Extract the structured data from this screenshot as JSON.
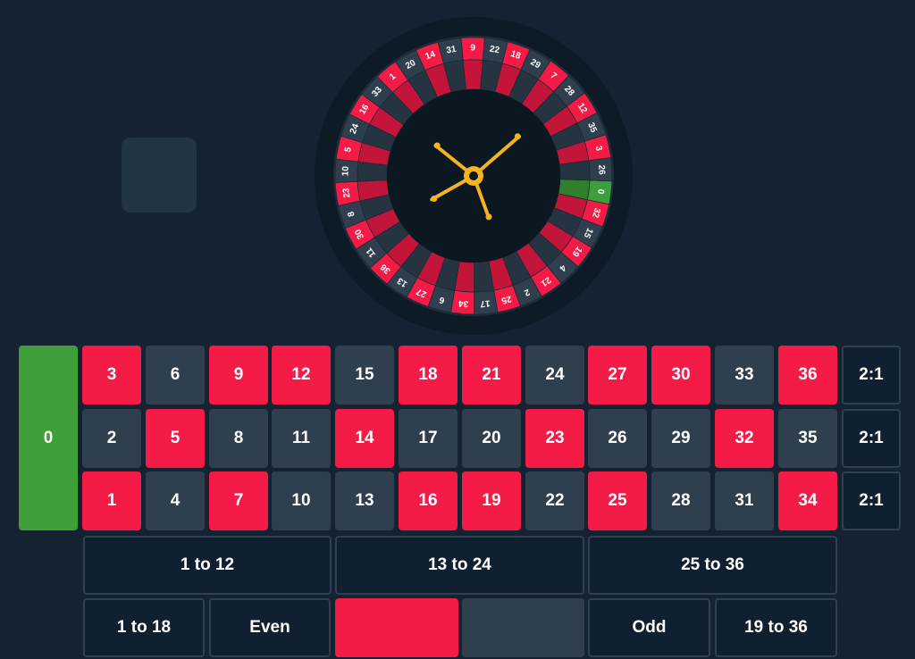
{
  "colors": {
    "background": "#142231",
    "red": "#f41b46",
    "black": "#2f3f4e",
    "green": "#3e9e3a",
    "pointer": "#f5b321"
  },
  "last_result": "",
  "wheel": {
    "sequence": [
      0,
      32,
      15,
      19,
      4,
      21,
      2,
      25,
      17,
      34,
      6,
      27,
      13,
      36,
      11,
      30,
      8,
      23,
      10,
      5,
      24,
      16,
      33,
      1,
      20,
      14,
      31,
      9,
      22,
      18,
      29,
      7,
      28,
      12,
      35,
      3,
      26
    ],
    "red_numbers": [
      1,
      3,
      5,
      7,
      9,
      12,
      14,
      16,
      18,
      19,
      21,
      23,
      25,
      27,
      30,
      32,
      34,
      36
    ],
    "icon": "roulette-spinner-icon"
  },
  "board": {
    "zero": "0",
    "rows": [
      [
        "3",
        "6",
        "9",
        "12",
        "15",
        "18",
        "21",
        "24",
        "27",
        "30",
        "33",
        "36"
      ],
      [
        "2",
        "5",
        "8",
        "11",
        "14",
        "17",
        "20",
        "23",
        "26",
        "29",
        "32",
        "35"
      ],
      [
        "1",
        "4",
        "7",
        "10",
        "13",
        "16",
        "19",
        "22",
        "25",
        "28",
        "31",
        "34"
      ]
    ],
    "columns": [
      "2:1",
      "2:1",
      "2:1"
    ],
    "dozens": [
      "1 to 12",
      "13 to 24",
      "25 to 36"
    ],
    "outside": {
      "low": "1 to 18",
      "even": "Even",
      "red": "",
      "black": "",
      "odd": "Odd",
      "high": "19 to 36"
    }
  }
}
